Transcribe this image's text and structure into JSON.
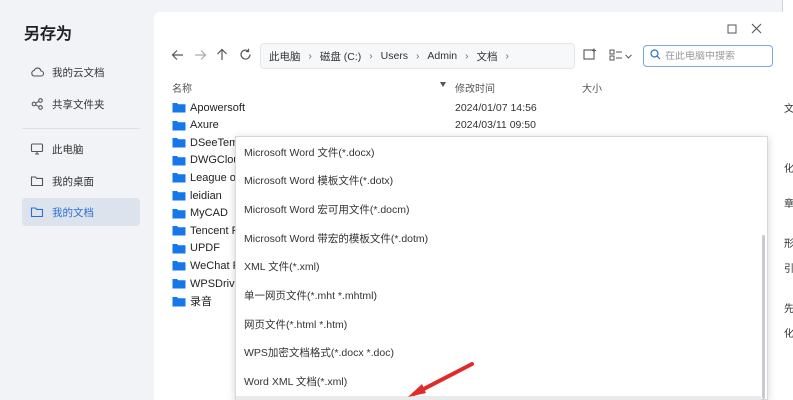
{
  "dialog": {
    "title": "另存为"
  },
  "sidebar": {
    "items": [
      {
        "label": "我的云文档",
        "icon": "cloud-icon"
      },
      {
        "label": "共享文件夹",
        "icon": "share-folder-icon"
      },
      {
        "label": "此电脑",
        "icon": "computer-icon"
      },
      {
        "label": "我的桌面",
        "icon": "desktop-folder-icon"
      },
      {
        "label": "我的文档",
        "icon": "documents-folder-icon",
        "active": true
      }
    ]
  },
  "window": {
    "maximize_icon": "maximize-icon",
    "close_icon": "close-icon"
  },
  "nav": {
    "back": "back-arrow-icon",
    "forward": "forward-arrow-icon",
    "up": "up-arrow-icon",
    "refresh": "refresh-icon"
  },
  "breadcrumb": [
    "此电脑",
    "磁盘 (C:)",
    "Users",
    "Admin",
    "文档"
  ],
  "search": {
    "placeholder": "在此电脑中搜索"
  },
  "columns": {
    "name": "名称",
    "modified": "修改时间",
    "size": "大小"
  },
  "files": [
    {
      "name": "Apowersoft",
      "date": "2024/01/07 14:56"
    },
    {
      "name": "Axure",
      "date": "2024/03/11 09:50"
    },
    {
      "name": "DSeeTem",
      "date": ""
    },
    {
      "name": "DWGClou",
      "date": ""
    },
    {
      "name": "League o",
      "date": ""
    },
    {
      "name": "leidian",
      "date": ""
    },
    {
      "name": "MyCAD",
      "date": ""
    },
    {
      "name": "Tencent F",
      "date": ""
    },
    {
      "name": "UPDF",
      "date": ""
    },
    {
      "name": "WeChat F",
      "date": ""
    },
    {
      "name": "WPSDrive",
      "date": ""
    },
    {
      "name": "录音",
      "date": ""
    }
  ],
  "file_types": [
    "Microsoft Word 文件(*.docx)",
    "Microsoft Word 模板文件(*.dotx)",
    "Microsoft Word 宏可用文件(*.docm)",
    "Microsoft Word 带宏的模板文件(*.dotm)",
    "XML 文件(*.xml)",
    "单一网页文件(*.mht *.mhtml)",
    "网页文件(*.html *.htm)",
    "WPS加密文档格式(*.docx *.doc)",
    "Word XML 文档(*.xml)"
  ],
  "colors": {
    "folder": "#1677e8",
    "accent": "#2b6fd6",
    "arrow": "#e02b2b"
  }
}
